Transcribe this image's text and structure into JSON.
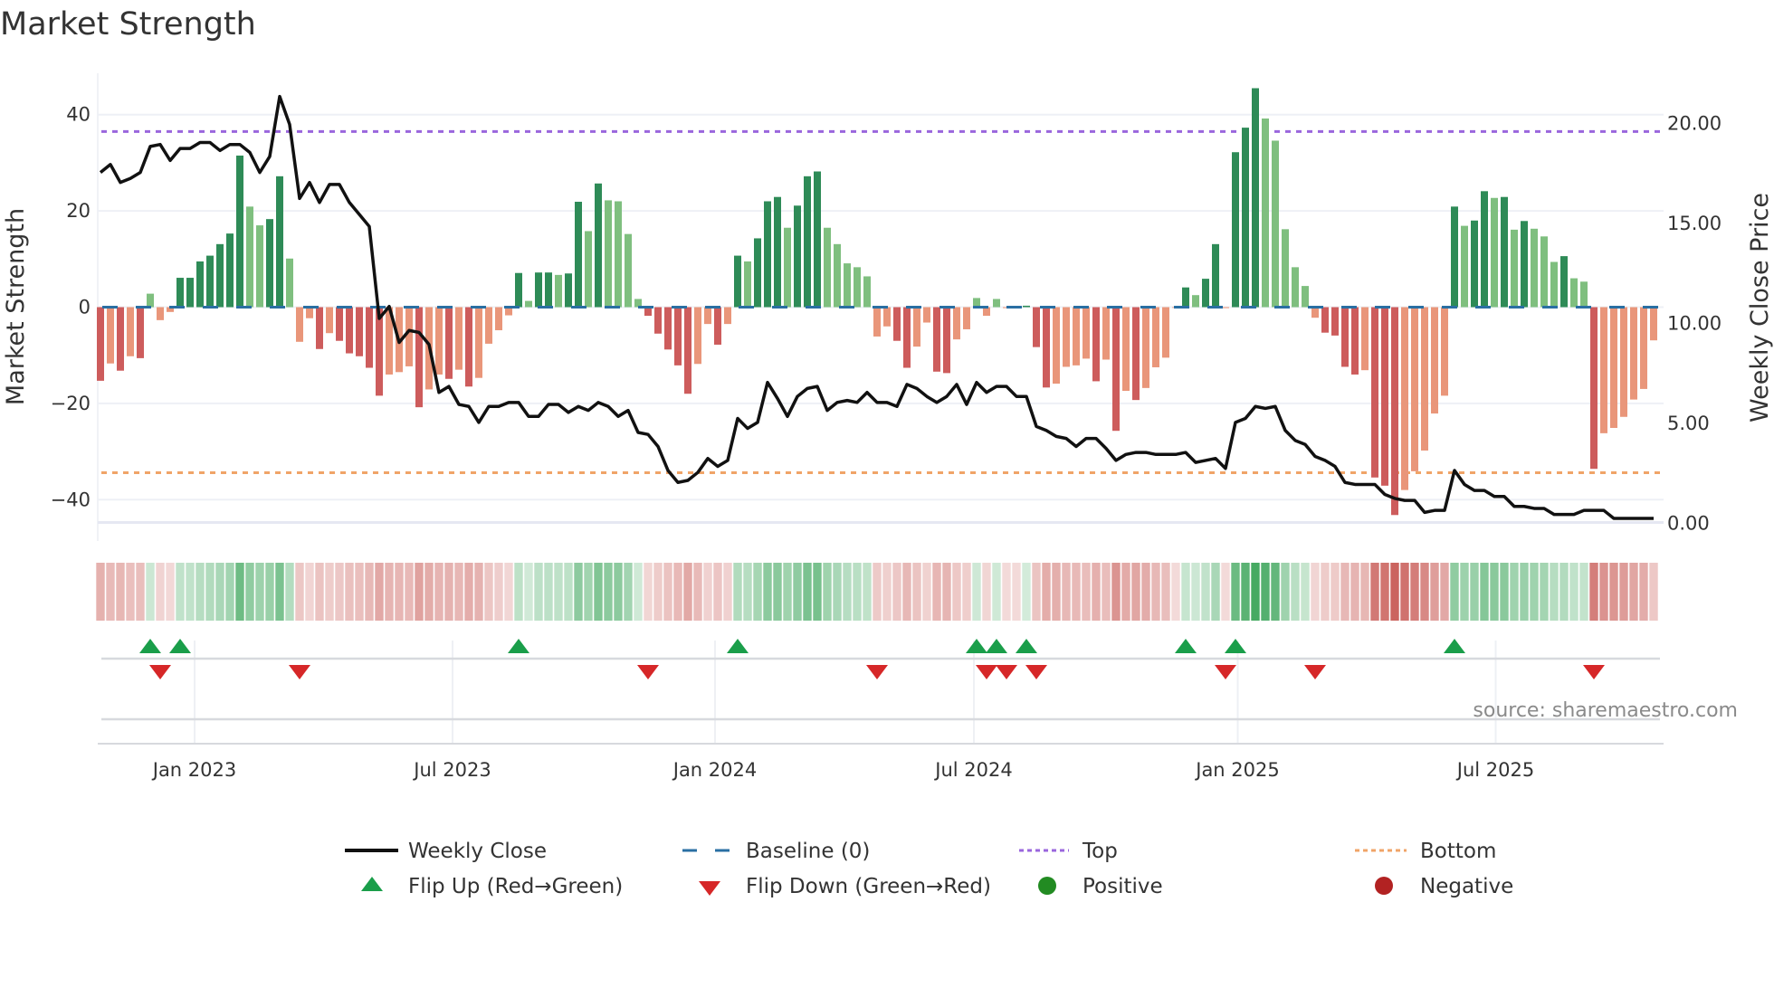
{
  "chart_data": {
    "type": "bar",
    "title": "Market Strength",
    "ylabel": "Market Strength",
    "y2label": "Weekly Close Price",
    "ylim": [
      -48.6,
      48.6
    ],
    "y2lim": [
      -0.93,
      22.46
    ],
    "yticks": [
      "40",
      "20",
      "0",
      "−20",
      "−40"
    ],
    "ytick_values": [
      40,
      20,
      0,
      -20,
      -40
    ],
    "y2ticks": [
      "20.00",
      "15.00",
      "10.00",
      "5.00",
      "0.00"
    ],
    "y2tick_values": [
      20,
      15,
      10,
      5,
      0
    ],
    "xticks": [
      "Jan 2023",
      "Jul 2023",
      "Jan 2024",
      "Jul 2024",
      "Jan 2025",
      "Jul 2025"
    ],
    "frequency": "weekly",
    "top_level": 36.5,
    "bottom_level": -34.4,
    "baseline": 0,
    "strength": [
      -15.3,
      -11.7,
      -13.2,
      -10.2,
      -10.6,
      2.8,
      -2.7,
      -1.0,
      6.1,
      6.1,
      9.5,
      10.7,
      13.1,
      15.3,
      31.5,
      20.9,
      17.0,
      18.3,
      27.2,
      10.1,
      -7.2,
      -2.3,
      -8.7,
      -5.4,
      -7.0,
      -9.6,
      -10.2,
      -12.6,
      -18.4,
      -14.0,
      -13.5,
      -12.3,
      -20.8,
      -17.1,
      -14.0,
      -14.9,
      -13.0,
      -16.5,
      -14.7,
      -7.6,
      -4.8,
      -1.7,
      7.1,
      1.3,
      7.2,
      7.2,
      6.7,
      7.0,
      21.9,
      15.8,
      25.7,
      22.2,
      22.0,
      15.2,
      1.7,
      -1.8,
      -5.5,
      -8.8,
      -12.1,
      -18.0,
      -11.8,
      -3.5,
      -7.8,
      -3.5,
      10.7,
      9.5,
      14.3,
      22.0,
      22.9,
      16.5,
      21.1,
      27.2,
      28.2,
      16.5,
      13.1,
      9.1,
      8.3,
      6.4,
      -6.1,
      -4.0,
      -7.0,
      -12.6,
      -8.2,
      -3.2,
      -13.4,
      -13.7,
      -6.7,
      -4.6,
      1.9,
      -1.8,
      1.7,
      -0.2,
      -0.1,
      0.3,
      -8.3,
      -16.7,
      -15.9,
      -12.4,
      -12.1,
      -10.7,
      -15.4,
      -10.9,
      -25.7,
      -17.4,
      -19.3,
      -16.8,
      -12.5,
      -10.5,
      -0.1,
      4.1,
      2.5,
      5.9,
      13.1,
      -0.2,
      32.2,
      37.3,
      45.5,
      39.2,
      34.6,
      16.2,
      8.3,
      4.4,
      -2.2,
      -5.3,
      -5.9,
      -12.4,
      -14.0,
      -13.1,
      -35.4,
      -37.1,
      -43.2,
      -38.0,
      -34.1,
      -29.8,
      -22.1,
      -18.4,
      20.9,
      16.9,
      18.0,
      24.1,
      22.7,
      22.9,
      16.1,
      17.9,
      16.3,
      14.7,
      9.4,
      10.6,
      6.0,
      5.3,
      -33.6,
      -26.2,
      -25.1,
      -22.8,
      -19.2,
      -17.0,
      -6.9
    ],
    "weekly_close": [
      17.5,
      17.9,
      17.0,
      17.2,
      17.5,
      18.8,
      18.9,
      18.1,
      18.7,
      18.7,
      19.0,
      19.0,
      18.6,
      18.9,
      18.9,
      18.5,
      17.5,
      18.3,
      21.3,
      19.9,
      16.2,
      17.0,
      16.0,
      16.9,
      16.9,
      16.0,
      15.4,
      14.8,
      10.2,
      10.8,
      9.0,
      9.6,
      9.5,
      8.9,
      6.5,
      6.8,
      5.9,
      5.8,
      5.0,
      5.8,
      5.8,
      6.0,
      6.0,
      5.3,
      5.3,
      5.9,
      5.9,
      5.5,
      5.8,
      5.6,
      6.0,
      5.8,
      5.3,
      5.6,
      4.5,
      4.4,
      3.8,
      2.6,
      2.0,
      2.1,
      2.5,
      3.2,
      2.8,
      3.1,
      5.2,
      4.7,
      5.0,
      7.0,
      6.2,
      5.3,
      6.3,
      6.7,
      6.8,
      5.6,
      6.0,
      6.1,
      6.0,
      6.5,
      6.0,
      6.0,
      5.8,
      6.9,
      6.7,
      6.3,
      6.0,
      6.3,
      6.9,
      5.9,
      7.0,
      6.5,
      6.8,
      6.8,
      6.3,
      6.3,
      4.8,
      4.6,
      4.3,
      4.2,
      3.8,
      4.2,
      4.2,
      3.7,
      3.1,
      3.4,
      3.5,
      3.5,
      3.4,
      3.4,
      3.4,
      3.5,
      3.0,
      3.1,
      3.2,
      2.7,
      5.0,
      5.2,
      5.8,
      5.7,
      5.8,
      4.6,
      4.1,
      3.9,
      3.3,
      3.1,
      2.8,
      2.0,
      1.9,
      1.9,
      1.9,
      1.4,
      1.2,
      1.1,
      1.1,
      0.5,
      0.6,
      0.6,
      2.6,
      1.9,
      1.6,
      1.6,
      1.3,
      1.3,
      0.8,
      0.8,
      0.7,
      0.7,
      0.4,
      0.4,
      0.4,
      0.6,
      0.6,
      0.6,
      0.2,
      0.2,
      0.2,
      0.2,
      0.2
    ],
    "colors": {
      "rising_positive": "#2e8b57",
      "falling_positive": "#7fbf7f",
      "rising_negative": "#cd5c5c",
      "falling_negative": "#e9967a",
      "baseline": "#2a6fa3",
      "top": "#9a66dd",
      "bottom": "#f0a468",
      "close": "#111111",
      "flip_up": "#1a9e4a",
      "flip_down": "#d62728",
      "positive": "#228b22",
      "negative": "#b22222"
    },
    "legend": {
      "placement": "bottom",
      "items": [
        "Weekly Close",
        "Baseline (0)",
        "Top",
        "Bottom",
        "Flip Up (Red→Green)",
        "Flip Down (Green→Red)",
        "Positive",
        "Negative"
      ]
    },
    "source": "source: sharemaestro.com"
  }
}
